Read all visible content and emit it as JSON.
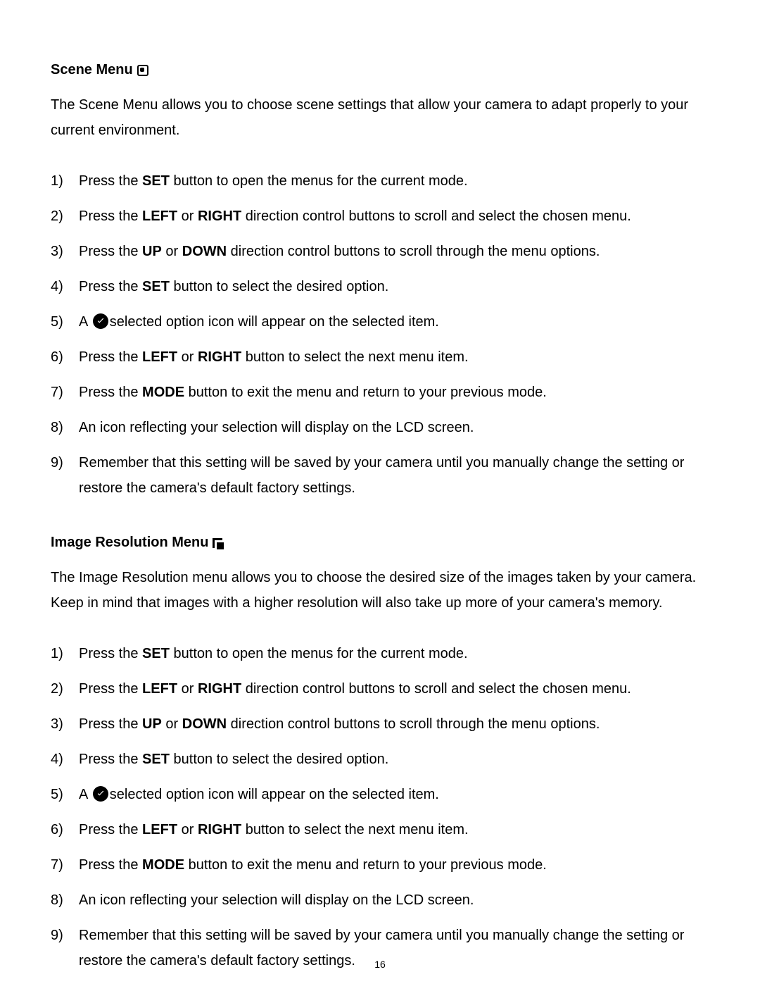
{
  "pageNumber": "16",
  "sections": [
    {
      "heading": "Scene Menu",
      "icon": "scene",
      "intro": "The Scene Menu allows you to choose scene settings that allow your camera to adapt properly to your current environment.",
      "steps": [
        {
          "pre": "Press the ",
          "bold": "SET",
          "post": " button to open the menus for the current mode."
        },
        {
          "pre": "Press the ",
          "bold": "LEFT",
          "mid": " or ",
          "bold2": "RIGHT",
          "post": " direction control buttons to scroll and select the chosen menu."
        },
        {
          "pre": "Press the ",
          "bold": "UP",
          "mid": " or ",
          "bold2": "DOWN",
          "post": " direction control buttons to scroll through the menu options."
        },
        {
          "pre": "Press the ",
          "bold": "SET",
          "post": " button to select the desired option."
        },
        {
          "pre": "A ",
          "check": true,
          "post": "selected option icon will appear on the selected item."
        },
        {
          "pre": "Press the ",
          "bold": "LEFT",
          "mid": " or ",
          "bold2": "RIGHT",
          "post": " button to select the next menu item."
        },
        {
          "pre": "Press the ",
          "bold": "MODE",
          "post": " button to exit the menu and return to your previous mode."
        },
        {
          "pre": "An icon reflecting your selection will display on the LCD screen."
        },
        {
          "pre": "Remember that this setting will be saved by your camera until you manually change the setting or restore the camera's default factory settings."
        }
      ]
    },
    {
      "heading": "Image Resolution Menu",
      "icon": "resolution",
      "intro": "The Image Resolution menu allows you to choose the desired size of the images taken by your camera. Keep in mind that images with a higher resolution will also take up more of your camera's memory.",
      "steps": [
        {
          "pre": "Press the ",
          "bold": "SET",
          "post": " button to open the menus for the current mode."
        },
        {
          "pre": "Press the ",
          "bold": "LEFT",
          "mid": " or ",
          "bold2": "RIGHT",
          "post": " direction control buttons to scroll and select the chosen menu."
        },
        {
          "pre": "Press the ",
          "bold": "UP",
          "mid": " or ",
          "bold2": "DOWN",
          "post": " direction control buttons to scroll through the menu options."
        },
        {
          "pre": "Press the ",
          "bold": "SET",
          "post": " button to select the desired option."
        },
        {
          "pre": "A ",
          "check": true,
          "post": "selected option icon will appear on the selected item."
        },
        {
          "pre": "Press the ",
          "bold": "LEFT",
          "mid": " or ",
          "bold2": "RIGHT",
          "post": " button to select the next menu item."
        },
        {
          "pre": "Press the ",
          "bold": "MODE",
          "post": " button to exit the menu and return to your previous mode."
        },
        {
          "pre": "An icon reflecting your selection will display on the LCD screen."
        },
        {
          "pre": "Remember that this setting will be saved by your camera until you manually change the setting or restore the camera's default factory settings."
        }
      ]
    }
  ]
}
